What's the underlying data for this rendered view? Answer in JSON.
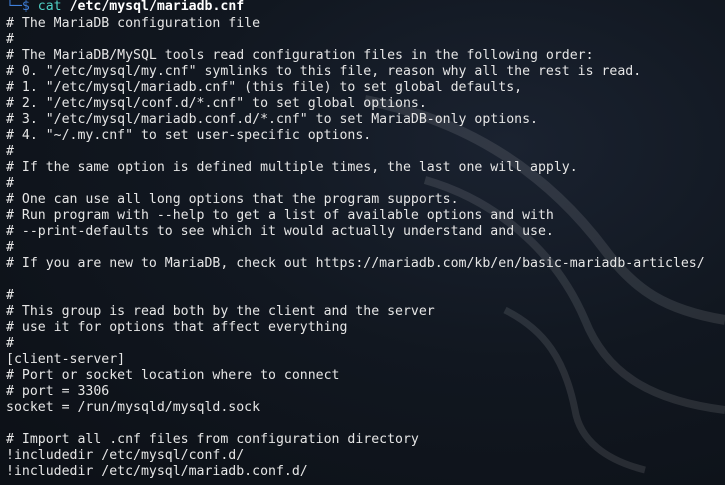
{
  "prompt": {
    "corner": "└─",
    "symbol": "$",
    "command": "cat",
    "argument": "/etc/mysql/mariadb.cnf"
  },
  "lines": [
    "# The MariaDB configuration file",
    "#",
    "# The MariaDB/MySQL tools read configuration files in the following order:",
    "# 0. \"/etc/mysql/my.cnf\" symlinks to this file, reason why all the rest is read.",
    "# 1. \"/etc/mysql/mariadb.cnf\" (this file) to set global defaults,",
    "# 2. \"/etc/mysql/conf.d/*.cnf\" to set global options.",
    "# 3. \"/etc/mysql/mariadb.conf.d/*.cnf\" to set MariaDB-only options.",
    "# 4. \"~/.my.cnf\" to set user-specific options.",
    "#",
    "# If the same option is defined multiple times, the last one will apply.",
    "#",
    "# One can use all long options that the program supports.",
    "# Run program with --help to get a list of available options and with",
    "# --print-defaults to see which it would actually understand and use.",
    "#",
    "# If you are new to MariaDB, check out https://mariadb.com/kb/en/basic-mariadb-articles/",
    "",
    "#",
    "# This group is read both by the client and the server",
    "# use it for options that affect everything",
    "#",
    "[client-server]",
    "# Port or socket location where to connect",
    "# port = 3306",
    "socket = /run/mysqld/mysqld.sock",
    "",
    "# Import all .cnf files from configuration directory",
    "!includedir /etc/mysql/conf.d/",
    "!includedir /etc/mysql/mariadb.conf.d/"
  ]
}
